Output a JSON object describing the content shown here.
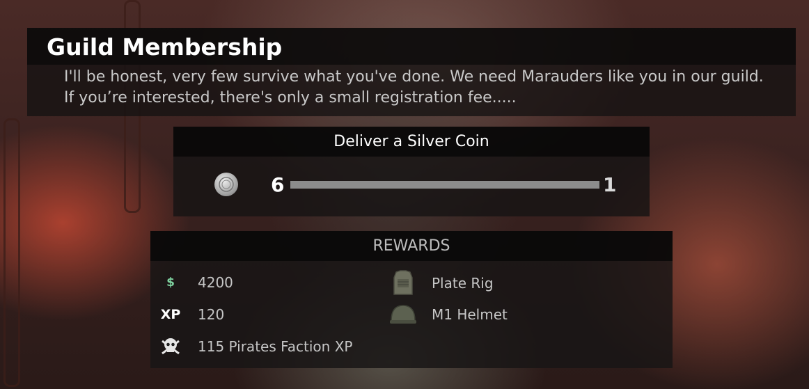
{
  "dialog": {
    "title": "Guild Membership",
    "description_line1": "I'll be honest, very few survive what you've done. We need Marauders like you in our guild.",
    "description_line2": "If you’re interested, there's only a small registration fee....."
  },
  "objective": {
    "title": "Deliver a Silver Coin",
    "item_icon": "silver-coin-icon",
    "current_count": "6",
    "required_count": "1",
    "progress": 1.0
  },
  "rewards": {
    "title": "REWARDS",
    "items": [
      {
        "icon": "dollar-icon",
        "text": "4200"
      },
      {
        "icon": "xp-icon",
        "text": "120"
      },
      {
        "icon": "pirate-skull-icon",
        "text": "115 Pirates Faction XP"
      },
      {
        "icon": "plate-rig-icon",
        "text": "Plate Rig"
      },
      {
        "icon": "m1-helmet-icon",
        "text": "M1 Helmet"
      }
    ]
  },
  "colors": {
    "money_green": "#7fd3a0",
    "panel_dark": "#141212",
    "progress_bar": "#8c8c8c"
  }
}
